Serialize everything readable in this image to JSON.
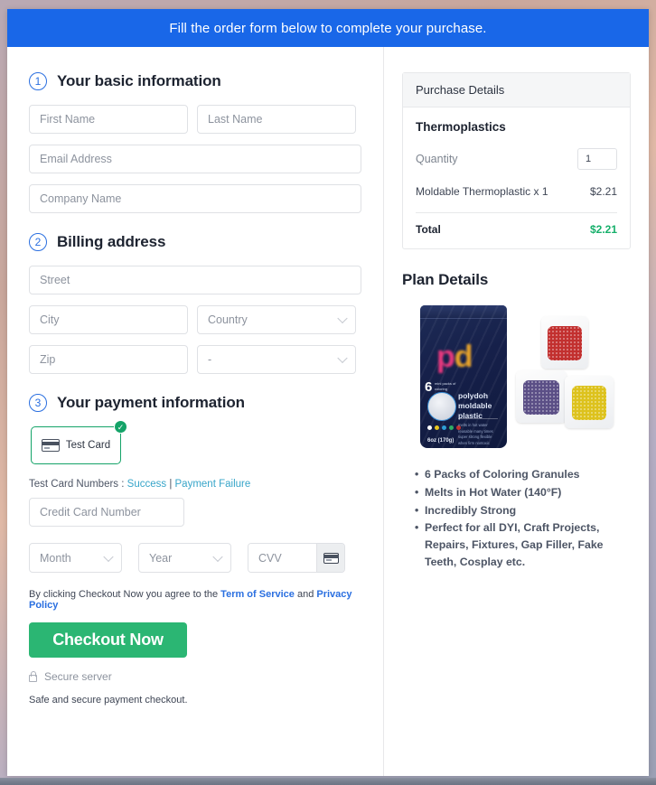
{
  "banner": {
    "message": "Fill the order form below to complete your purchase."
  },
  "sections": {
    "basic": {
      "num": "1",
      "title": "Your basic information"
    },
    "billing": {
      "num": "2",
      "title": "Billing address"
    },
    "payment": {
      "num": "3",
      "title": "Your payment information"
    }
  },
  "fields": {
    "first_name": "First Name",
    "last_name": "Last Name",
    "email": "Email Address",
    "company": "Company Name",
    "street": "Street",
    "city": "City",
    "country": "Country",
    "zip": "Zip",
    "state": "-",
    "credit_card": "Credit Card Number",
    "month": "Month",
    "year": "Year",
    "cvv": "CVV"
  },
  "payment": {
    "test_card_label": "Test  Card",
    "test_numbers_prefix": "Test Card Numbers : ",
    "success_link": "Success",
    "separator": " | ",
    "failure_link": "Payment Failure"
  },
  "footer": {
    "terms_prefix": "By clicking Checkout Now you agree to the ",
    "terms_link": "Term of Service",
    "terms_mid": " and ",
    "privacy_link": "Privacy Policy",
    "checkout_label": "Checkout Now",
    "secure_server": "Secure server",
    "safe_note": "Safe and secure payment checkout."
  },
  "purchase": {
    "header": "Purchase Details",
    "product": "Thermoplastics",
    "quantity_label": "Quantity",
    "quantity_value": "1",
    "line_item": "Moldable Thermoplastic x 1",
    "line_price": "$2.21",
    "total_label": "Total",
    "total_value": "$2.21"
  },
  "plan": {
    "title": "Plan Details",
    "product_brand": "pd",
    "product_name": "polydoh\nmoldable\nplastic",
    "product_name_l1": "polydoh",
    "product_name_l2": "moldable",
    "product_name_l3": "plastic",
    "product_fine": "melts in hot water\nreusable many times\nsuper strong\nflexible when firm\nnontoxic",
    "product_six": "6",
    "product_six_text": "mini packs of coloring granules",
    "product_weight": "6oz (170g)",
    "features": [
      "6 Packs of Coloring Granules",
      "Melts in Hot Water (140°F)",
      "Incredibly Strong",
      "Perfect for all DYI, Craft Projects, Repairs, Fixtures, Gap Filler, Fake Teeth, Cosplay etc."
    ]
  },
  "colors": {
    "banner_blue": "#1967e8",
    "accent_blue": "#2a6fe0",
    "success_green": "#14a368",
    "checkout_green": "#2bb673",
    "total_green": "#17b06b",
    "link_teal": "#37a5c9"
  }
}
